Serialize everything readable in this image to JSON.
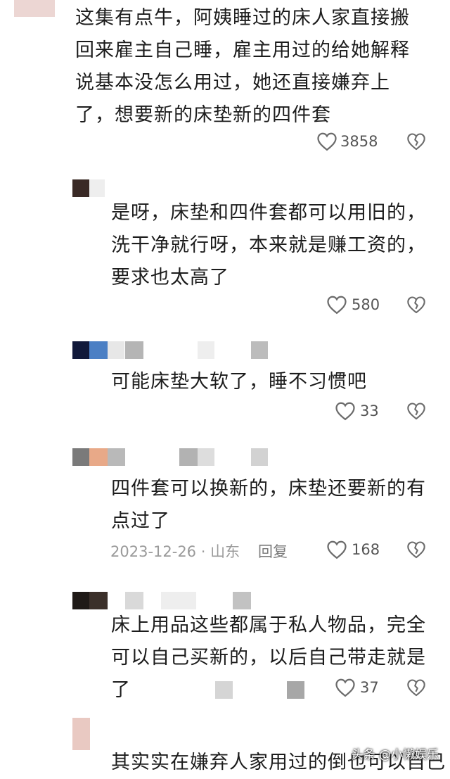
{
  "comments": [
    {
      "text": "这集有点牛，阿姨睡过的床人家直接搬回来雇主自己睡，雇主用过的给她解释说基本没怎么用过，她还直接嫌弃上了，想要新的床垫新的四件套",
      "likes": "3858"
    },
    {
      "text": "是呀，床垫和四件套都可以用旧的，洗干净就行呀，本来就是赚工资的，要求也太高了",
      "likes": "580"
    },
    {
      "text": "可能床垫大软了，睡不习惯吧",
      "likes": "33"
    },
    {
      "text": "四件套可以换新的，床垫还要新的有点过了",
      "likes": "168",
      "date": "2023-12-26 · 山东",
      "reply": "回复"
    },
    {
      "text": "床上用品这些都属于私人物品，完全可以自己买新的，以后自己带走就是了",
      "likes": "37"
    },
    {
      "text": "其实实在嫌弃人家用过的倒也可以自己"
    }
  ],
  "watermark": "头条 @小懒娱乐",
  "colors": {
    "text": "#1c1c1c",
    "meta": "#9a9a9a",
    "icon": "#6b6b6b"
  },
  "icons": [
    "heart-icon",
    "broken-heart-icon"
  ]
}
